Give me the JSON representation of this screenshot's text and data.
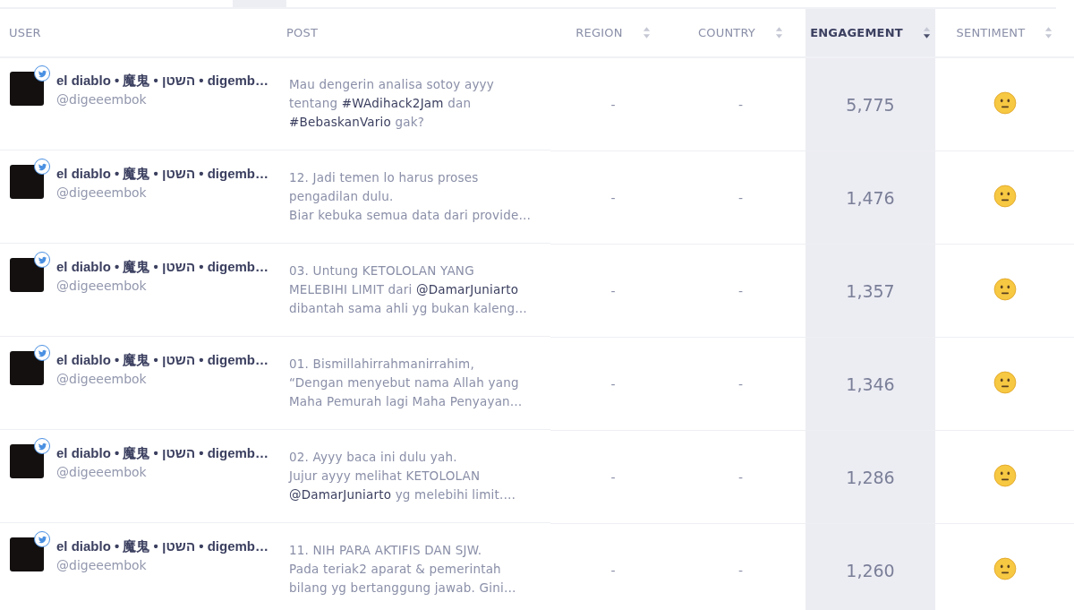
{
  "columns": [
    {
      "label": "USER",
      "kind": "plain"
    },
    {
      "label": "POST",
      "kind": "plain"
    },
    {
      "label": "REGION",
      "kind": "sortable",
      "selected": false
    },
    {
      "label": "COUNTRY",
      "kind": "sortable",
      "selected": false
    },
    {
      "label": "ENGAGEMENT",
      "kind": "sortable",
      "selected": true
    },
    {
      "label": "SENTIMENT",
      "kind": "sortable",
      "selected": false
    }
  ],
  "rows": [
    {
      "name": "el diablo • 魔鬼 • השטן • digemb…",
      "handle": "@digeeembok",
      "post": [
        [
          {
            "text": "Mau dengerin analisa sotoy ayyy"
          }
        ],
        [
          {
            "text": "tentang "
          },
          {
            "text": "#WAdihack2Jam",
            "kind": "link"
          },
          {
            "text": " dan"
          }
        ],
        [
          {
            "text": "#BebaskanVario",
            "kind": "link"
          },
          {
            "text": " gak?"
          }
        ]
      ],
      "region": "-",
      "country": "-",
      "engagement": "5,775"
    },
    {
      "name": "el diablo • 魔鬼 • השטן • digemb…",
      "handle": "@digeeembok",
      "post": [
        [
          {
            "text": "12. Jadi temen lo harus proses"
          }
        ],
        [
          {
            "text": "pengadilan dulu."
          }
        ],
        [
          {
            "text": "Biar kebuka semua data dari provide…"
          }
        ]
      ],
      "region": "-",
      "country": "-",
      "engagement": "1,476"
    },
    {
      "name": "el diablo • 魔鬼 • השטן • digemb…",
      "handle": "@digeeembok",
      "post": [
        [
          {
            "text": "03. Untung KETOLOLAN YANG"
          }
        ],
        [
          {
            "text": "MELEBIHI LIMIT dari "
          },
          {
            "text": "@DamarJuniarto",
            "kind": "link"
          }
        ],
        [
          {
            "text": "dibantah sama ahli yg bukan kaleng…"
          }
        ]
      ],
      "region": "-",
      "country": "-",
      "engagement": "1,357"
    },
    {
      "name": "el diablo • 魔鬼 • השטן • digemb…",
      "handle": "@digeeembok",
      "post": [
        [
          {
            "text": "01. Bismillahirrahmanirrahim,"
          }
        ],
        [
          {
            "text": "“Dengan menyebut nama Allah yang"
          }
        ],
        [
          {
            "text": "Maha Pemurah lagi Maha Penyayan…"
          }
        ]
      ],
      "region": "-",
      "country": "-",
      "engagement": "1,346"
    },
    {
      "name": "el diablo • 魔鬼 • השטן • digemb…",
      "handle": "@digeeembok",
      "post": [
        [
          {
            "text": "02. Ayyy baca ini dulu yah."
          }
        ],
        [
          {
            "text": "Jujur ayyy melihat KETOLOLAN"
          }
        ],
        [
          {
            "text": "@DamarJuniarto",
            "kind": "link"
          },
          {
            "text": " yg melebihi limit.…"
          }
        ]
      ],
      "region": "-",
      "country": "-",
      "engagement": "1,286"
    },
    {
      "name": "el diablo • 魔鬼 • השטן • digemb…",
      "handle": "@digeeembok",
      "post": [
        [
          {
            "text": "11. NIH PARA AKTIFIS DAN SJW."
          }
        ],
        [
          {
            "text": "Pada teriak2 aparat & pemerintah"
          }
        ],
        [
          {
            "text": "bilang yg bertanggung jawab. Gini…"
          }
        ]
      ],
      "region": "-",
      "country": "-",
      "engagement": "1,260"
    }
  ]
}
